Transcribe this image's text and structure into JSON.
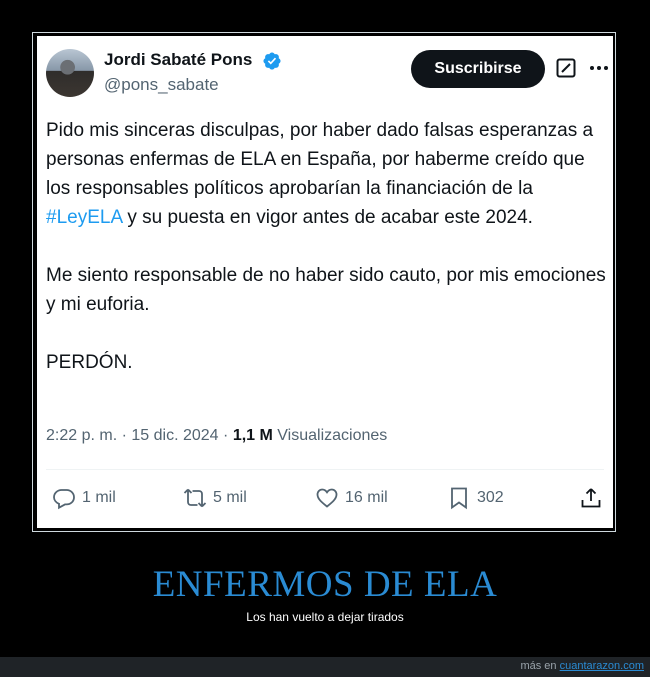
{
  "tweet": {
    "author_name": "Jordi Sabaté Pons",
    "handle": "@pons_sabate",
    "subscribe_label": "Suscribirse",
    "body": {
      "p1_before": "Pido mis sinceras disculpas, por haber dado falsas esperanzas a personas enfermas de ELA en España, por haberme creído que los responsables políticos aprobarían la financiación de la ",
      "hashtag": "#LeyELA",
      "p1_after": " y su puesta en vigor antes de acabar este 2024.",
      "p2": "Me siento responsable de no haber sido cauto, por mis emociones y mi euforia.",
      "p3": "PERDÓN."
    },
    "meta": {
      "time": "2:22 p. m.",
      "date": "15 dic. 2024",
      "views_count": "1,1 M",
      "views_label": "Visualizaciones"
    },
    "actions": {
      "replies": "1 mil",
      "reposts": "5 mil",
      "likes": "16 mil",
      "bookmarks": "302"
    },
    "icons": [
      "avatar",
      "verified-badge-icon",
      "grok-icon",
      "more-icon",
      "reply-icon",
      "repost-icon",
      "like-icon",
      "bookmark-icon",
      "share-icon"
    ],
    "colors": {
      "verified": "#1d9bf0",
      "hashtag": "#1d9bf0",
      "subscribe_bg": "#0f1419"
    }
  },
  "caption": {
    "title": "ENFERMOS DE ELA",
    "subtitle": "Los han vuelto a dejar tirados",
    "colors": {
      "title": "#2a8bd3"
    }
  },
  "footer": {
    "prefix": "más en",
    "site": "cuantarazon.com"
  }
}
